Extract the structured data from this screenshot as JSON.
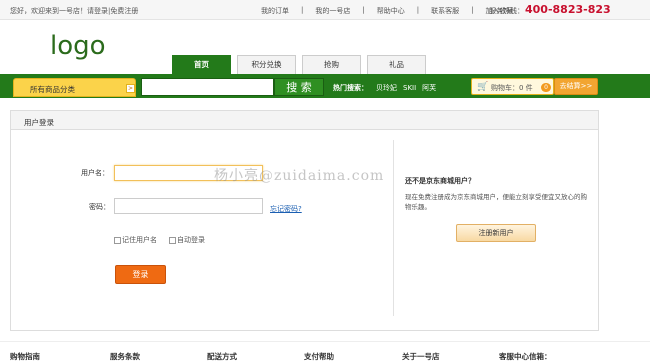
{
  "topbar": {
    "welcome": "您好，欢迎来到一号店！",
    "login_link": "请登录",
    "sep": "|",
    "register_link": "免费注册",
    "links": [
      "我的订单",
      "|",
      "我的一号店",
      "|",
      "帮助中心",
      "|",
      "联系客服",
      "|",
      "加入收藏"
    ],
    "hotline_label": "服务热线：",
    "hotline_number": "400-8823-823"
  },
  "logo": "logo",
  "tabs": [
    "首页",
    "积分兑换",
    "抢购",
    "礼品"
  ],
  "nav": {
    "all_categories": "所有商品分类",
    "search_value": "",
    "search_button": "搜 索",
    "hot_label": "热门搜索：",
    "hot_items": [
      "贝玲妃",
      "SKII",
      "阿芙"
    ],
    "cart_label": "购物车：",
    "cart_count_text": "0 件",
    "cart_badge": "0",
    "checkout": "去结算>>"
  },
  "login": {
    "heading": "用户登录",
    "username_label": "用户名：",
    "username_value": "",
    "password_label": "密码：",
    "password_value": "",
    "forgot": "忘记密码?",
    "remember": "记住用户名",
    "auto_login": "自动登录",
    "login_button": "登录"
  },
  "register": {
    "question": "还不是京东商城用户？",
    "description": "现在免费注册成为京东商城用户，便能立刻享受便宜又放心的购物乐趣。",
    "button": "注册新用户"
  },
  "watermark": "杨小亮@zuidaima.com",
  "footer": [
    "购物指南",
    "服务条款",
    "配送方式",
    "支付帮助",
    "关于一号店",
    "客服中心信箱："
  ]
}
